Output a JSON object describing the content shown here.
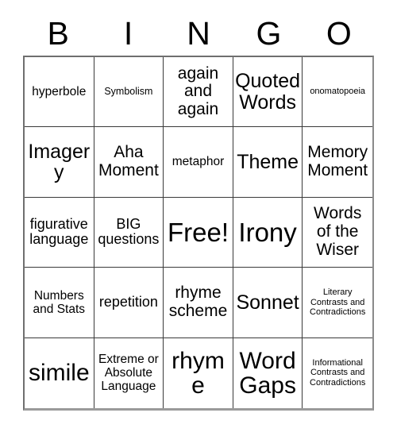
{
  "card": {
    "title": "BINGO",
    "header_letters": [
      "B",
      "I",
      "N",
      "G",
      "O"
    ],
    "free_space_label": "Free!",
    "rows": [
      [
        {
          "label": "hyperbole",
          "size": "md"
        },
        {
          "label": "Symbolism",
          "size": "sm"
        },
        {
          "label": "again and again",
          "size": "xl"
        },
        {
          "label": "Quoted Words",
          "size": "2xl"
        },
        {
          "label": "onomatopoeia",
          "size": "xs"
        }
      ],
      [
        {
          "label": "Imagery",
          "size": "2xl"
        },
        {
          "label": "Aha Moment",
          "size": "xl"
        },
        {
          "label": "metaphor",
          "size": "md"
        },
        {
          "label": "Theme",
          "size": "2xl"
        },
        {
          "label": "Memory Moment",
          "size": "xl"
        }
      ],
      [
        {
          "label": "figurative language",
          "size": "lg"
        },
        {
          "label": "BIG questions",
          "size": "lg"
        },
        {
          "label": "Free!",
          "size": "4xl"
        },
        {
          "label": "Irony",
          "size": "4xl"
        },
        {
          "label": "Words of the Wiser",
          "size": "xl"
        }
      ],
      [
        {
          "label": "Numbers and Stats",
          "size": "md"
        },
        {
          "label": "repetition",
          "size": "lg"
        },
        {
          "label": "rhyme scheme",
          "size": "xl"
        },
        {
          "label": "Sonnet",
          "size": "2xl"
        },
        {
          "label": "Literary Contrasts and Contradictions",
          "size": "xs"
        }
      ],
      [
        {
          "label": "simile",
          "size": "3xl"
        },
        {
          "label": "Extreme or Absolute Language",
          "size": "md"
        },
        {
          "label": "rhyme",
          "size": "3xl"
        },
        {
          "label": "Word Gaps",
          "size": "3xl"
        },
        {
          "label": "Informational Contrasts and Contradictions",
          "size": "xs"
        }
      ]
    ]
  },
  "colors": {
    "background": "#ffffff",
    "text": "#000000",
    "grid_line": "#3a3a3a",
    "outer_border": "#6f6f6f"
  }
}
